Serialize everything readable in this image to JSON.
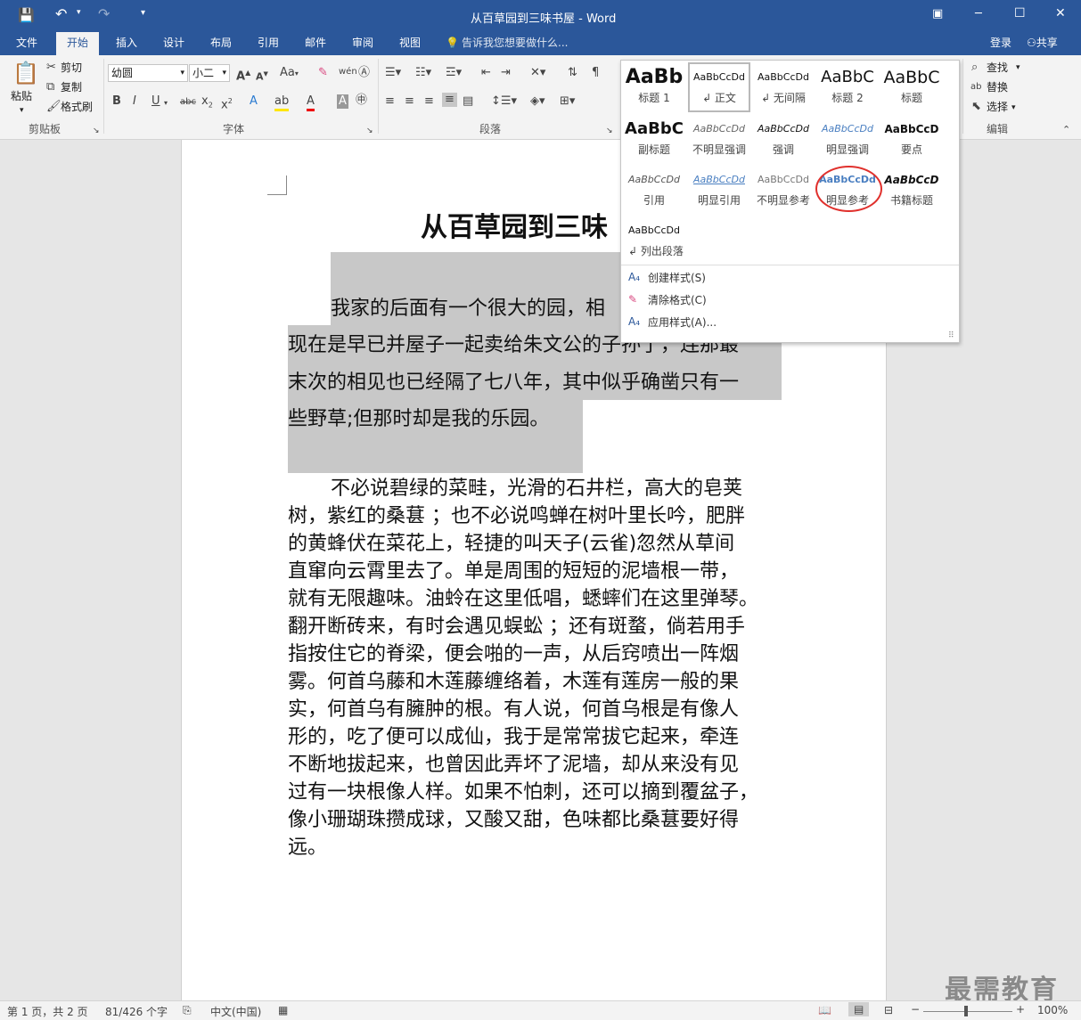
{
  "window": {
    "title": "从百草园到三味书屋 - Word",
    "restore_glyph": "▣",
    "minimize_glyph": "─",
    "maximize_glyph": "☐",
    "close_glyph": "✕"
  },
  "qat": {
    "save_icon": "save-icon",
    "undo_icon": "undo-icon",
    "redo_icon": "redo-icon"
  },
  "tabs": [
    "文件",
    "开始",
    "插入",
    "设计",
    "布局",
    "引用",
    "邮件",
    "审阅",
    "视图"
  ],
  "active_tab": "开始",
  "tellme": {
    "text": "告诉我您想要做什么..."
  },
  "account": {
    "signin": "登录",
    "share": "共享"
  },
  "clipboard": {
    "paste": "粘贴",
    "cut": "剪切",
    "copy": "复制",
    "format_painter": "格式刷",
    "label": "剪贴板"
  },
  "font": {
    "name": "幼圆",
    "size": "小二",
    "label": "字体",
    "case_btn": "Aa"
  },
  "paragraph": {
    "label": "段落"
  },
  "editing": {
    "find": "查找",
    "replace": "替换",
    "select": "选择",
    "label": "编辑"
  },
  "styles_gallery": {
    "rows": [
      [
        {
          "preview": "AaBb",
          "name": "标题 1"
        },
        {
          "preview": "AaBbCcDd",
          "name": "↲ 正文"
        },
        {
          "preview": "AaBbCcDd",
          "name": "↲ 无间隔"
        },
        {
          "preview": "AaBbC",
          "name": "标题 2"
        },
        {
          "preview": "AaBbC",
          "name": "标题"
        }
      ],
      [
        {
          "preview": "AaBbC",
          "name": "副标题"
        },
        {
          "preview": "AaBbCcDd",
          "name": "不明显强调"
        },
        {
          "preview": "AaBbCcDd",
          "name": "强调"
        },
        {
          "preview": "AaBbCcDd",
          "name": "明显强调"
        },
        {
          "preview": "AaBbCcD",
          "name": "要点"
        }
      ],
      [
        {
          "preview": "AaBbCcDd",
          "name": "引用"
        },
        {
          "preview": "AaBbCcDd",
          "name": "明显引用"
        },
        {
          "preview": "AaBbCcDd",
          "name": "不明显参考"
        },
        {
          "preview": "AaBbCcDd",
          "name": "明显参考"
        },
        {
          "preview": "AaBbCcD",
          "name": "书籍标题"
        }
      ],
      [
        {
          "preview": "AaBbCcDd",
          "name": "↲ 列出段落"
        }
      ]
    ],
    "menu": [
      "创建样式(S)",
      "清除格式(C)",
      "应用样式(A)..."
    ],
    "highlight_color": "#e0302c"
  },
  "document": {
    "title": "从百草园到三味",
    "para1_lines": [
      "我家的后面有一个很大的园，相",
      "现在是早已并屋子一起卖给朱文公的子孙了，连那最",
      "末次的相见也已经隔了七八年，其中似乎确凿只有一",
      "些野草;但那时却是我的乐园。"
    ],
    "para2_lines": [
      "不必说碧绿的菜畦，光滑的石井栏，高大的皂荚",
      "树，紫红的桑葚 ；也不必说鸣蝉在树叶里长吟，肥胖",
      "的黄蜂伏在菜花上，轻捷的叫天子(云雀)忽然从草间",
      "直窜向云霄里去了。单是周围的短短的泥墙根一带，",
      "就有无限趣味。油蛉在这里低唱，蟋蟀们在这里弹琴。",
      "翻开断砖来，有时会遇见蜈蚣 ；还有斑蝥，倘若用手",
      "指按住它的脊梁，便会啪的一声，从后窍喷出一阵烟",
      "雾。何首乌藤和木莲藤缠络着，木莲有莲房一般的果",
      "实，何首乌有臃肿的根。有人说，何首乌根是有像人",
      "形的，吃了便可以成仙，我于是常常拔它起来，牵连",
      "不断地拔起来，也曾因此弄坏了泥墙，却从来没有见",
      "过有一块根像人样。如果不怕刺，还可以摘到覆盆子，",
      "像小珊瑚珠攒成球，又酸又甜，色味都比桑葚要好得",
      "远。"
    ],
    "selection_color": "#c8c8c8"
  },
  "status": {
    "page": "第 1 页，共 2 页",
    "words": "81/426 个字",
    "lang": "中文(中国)",
    "zoom": "100%"
  },
  "watermark": "最需教育",
  "colors": {
    "brand": "#2b579a"
  }
}
